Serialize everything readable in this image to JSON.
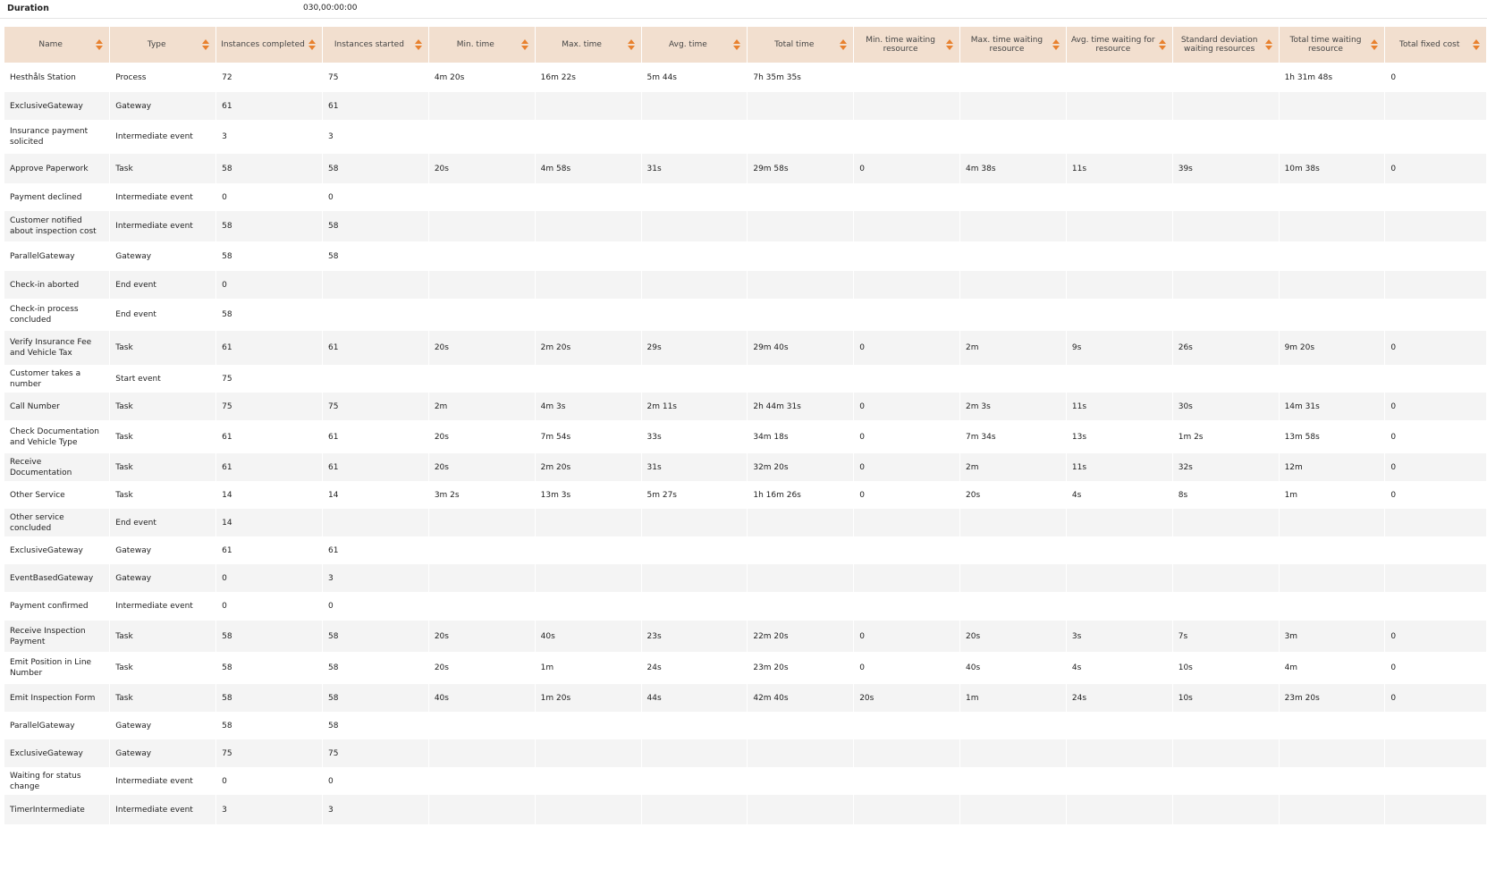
{
  "duration": {
    "label": "Duration",
    "value": "030,00:00:00"
  },
  "columns": [
    "Name",
    "Type",
    "Instances completed",
    "Instances started",
    "Min. time",
    "Max. time",
    "Avg. time",
    "Total time",
    "Min. time waiting resource",
    "Max. time waiting resource",
    "Avg. time waiting for resource",
    "Standard deviation waiting resources",
    "Total time waiting resource",
    "Total fixed cost"
  ],
  "rows": [
    [
      "Hesthåls Station",
      "Process",
      "72",
      "75",
      "4m 20s",
      "16m 22s",
      "5m 44s",
      "7h 35m 35s",
      "",
      "",
      "",
      "",
      "1h 31m 48s",
      "0"
    ],
    [
      "ExclusiveGateway",
      "Gateway",
      "61",
      "61",
      "",
      "",
      "",
      "",
      "",
      "",
      "",
      "",
      "",
      ""
    ],
    [
      "Insurance payment solicited",
      "Intermediate event",
      "3",
      "3",
      "",
      "",
      "",
      "",
      "",
      "",
      "",
      "",
      "",
      ""
    ],
    [
      "Approve Paperwork",
      "Task",
      "58",
      "58",
      "20s",
      "4m 58s",
      "31s",
      "29m 58s",
      "0",
      "4m 38s",
      "11s",
      "39s",
      "10m 38s",
      "0"
    ],
    [
      "Payment declined",
      "Intermediate event",
      "0",
      "0",
      "",
      "",
      "",
      "",
      "",
      "",
      "",
      "",
      "",
      ""
    ],
    [
      "Customer notified about inspection cost",
      "Intermediate event",
      "58",
      "58",
      "",
      "",
      "",
      "",
      "",
      "",
      "",
      "",
      "",
      ""
    ],
    [
      "ParallelGateway",
      "Gateway",
      "58",
      "58",
      "",
      "",
      "",
      "",
      "",
      "",
      "",
      "",
      "",
      ""
    ],
    [
      "Check-in aborted",
      "End event",
      "0",
      "",
      "",
      "",
      "",
      "",
      "",
      "",
      "",
      "",
      "",
      ""
    ],
    [
      "Check-in process concluded",
      "End event",
      "58",
      "",
      "",
      "",
      "",
      "",
      "",
      "",
      "",
      "",
      "",
      ""
    ],
    [
      "Verify Insurance Fee and Vehicle Tax",
      "Task",
      "61",
      "61",
      "20s",
      "2m 20s",
      "29s",
      "29m 40s",
      "0",
      "2m",
      "9s",
      "26s",
      "9m 20s",
      "0"
    ],
    [
      "Customer takes a number",
      "Start event",
      "75",
      "",
      "",
      "",
      "",
      "",
      "",
      "",
      "",
      "",
      "",
      ""
    ],
    [
      "Call Number",
      "Task",
      "75",
      "75",
      "2m",
      "4m 3s",
      "2m 11s",
      "2h 44m 31s",
      "0",
      "2m 3s",
      "11s",
      "30s",
      "14m 31s",
      "0"
    ],
    [
      "Check Documentation and Vehicle Type",
      "Task",
      "61",
      "61",
      "20s",
      "7m 54s",
      "33s",
      "34m 18s",
      "0",
      "7m 34s",
      "13s",
      "1m 2s",
      "13m 58s",
      "0"
    ],
    [
      "Receive Documentation",
      "Task",
      "61",
      "61",
      "20s",
      "2m 20s",
      "31s",
      "32m 20s",
      "0",
      "2m",
      "11s",
      "32s",
      "12m",
      "0"
    ],
    [
      "Other Service",
      "Task",
      "14",
      "14",
      "3m 2s",
      "13m 3s",
      "5m 27s",
      "1h 16m 26s",
      "0",
      "20s",
      "4s",
      "8s",
      "1m",
      "0"
    ],
    [
      "Other service concluded",
      "End event",
      "14",
      "",
      "",
      "",
      "",
      "",
      "",
      "",
      "",
      "",
      "",
      ""
    ],
    [
      "ExclusiveGateway",
      "Gateway",
      "61",
      "61",
      "",
      "",
      "",
      "",
      "",
      "",
      "",
      "",
      "",
      ""
    ],
    [
      "EventBasedGateway",
      "Gateway",
      "0",
      "3",
      "",
      "",
      "",
      "",
      "",
      "",
      "",
      "",
      "",
      ""
    ],
    [
      "Payment confirmed",
      "Intermediate event",
      "0",
      "0",
      "",
      "",
      "",
      "",
      "",
      "",
      "",
      "",
      "",
      ""
    ],
    [
      "Receive Inspection Payment",
      "Task",
      "58",
      "58",
      "20s",
      "40s",
      "23s",
      "22m 20s",
      "0",
      "20s",
      "3s",
      "7s",
      "3m",
      "0"
    ],
    [
      "Emit Position in Line Number",
      "Task",
      "58",
      "58",
      "20s",
      "1m",
      "24s",
      "23m 20s",
      "0",
      "40s",
      "4s",
      "10s",
      "4m",
      "0"
    ],
    [
      "Emit Inspection Form",
      "Task",
      "58",
      "58",
      "40s",
      "1m 20s",
      "44s",
      "42m 40s",
      "20s",
      "1m",
      "24s",
      "10s",
      "23m 20s",
      "0"
    ],
    [
      "ParallelGateway",
      "Gateway",
      "58",
      "58",
      "",
      "",
      "",
      "",
      "",
      "",
      "",
      "",
      "",
      ""
    ],
    [
      "ExclusiveGateway",
      "Gateway",
      "75",
      "75",
      "",
      "",
      "",
      "",
      "",
      "",
      "",
      "",
      "",
      ""
    ],
    [
      "Waiting for status change",
      "Intermediate event",
      "0",
      "0",
      "",
      "",
      "",
      "",
      "",
      "",
      "",
      "",
      "",
      ""
    ],
    [
      "TimerIntermediate",
      "Intermediate event",
      "3",
      "3",
      "",
      "",
      "",
      "",
      "",
      "",
      "",
      "",
      "",
      ""
    ]
  ],
  "colors": {
    "header_bg": "#f2dfcf",
    "sort_icon": "#e8812e",
    "row_alt": "#f4f4f4"
  },
  "icons": {
    "sort": "sort-arrows-icon"
  }
}
